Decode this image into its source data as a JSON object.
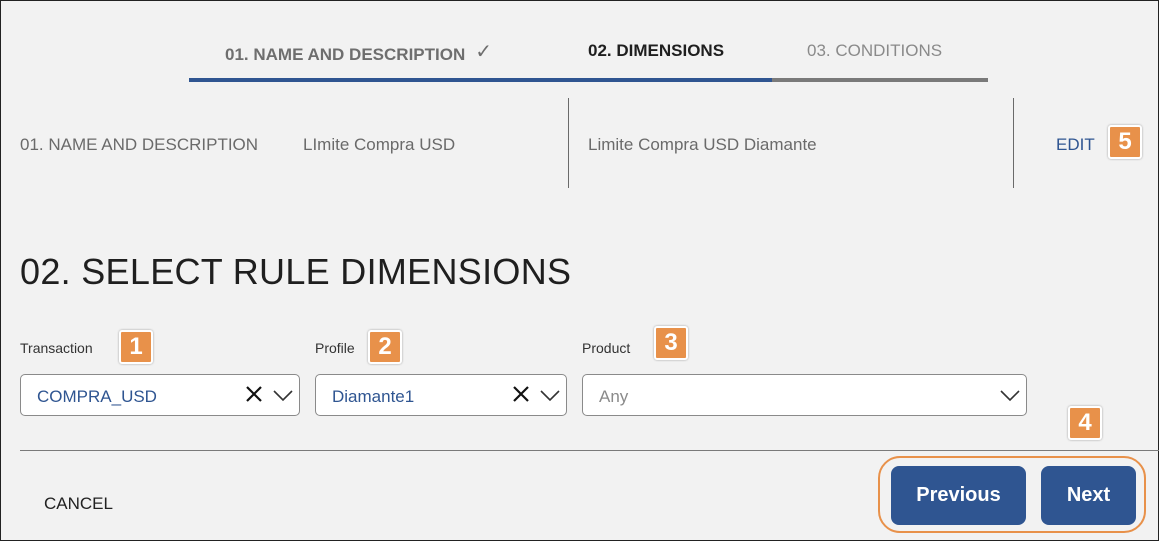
{
  "stepper": {
    "steps": [
      {
        "label": "01. NAME AND DESCRIPTION",
        "state": "completed",
        "icon": "check-icon"
      },
      {
        "label": "02. DIMENSIONS",
        "state": "active"
      },
      {
        "label": "03. CONDITIONS",
        "state": "upcoming"
      }
    ],
    "progress_fraction": 0.73,
    "colors": {
      "progress_fill": "#2f5591",
      "progress_track": "#7a7a7a"
    }
  },
  "summary": {
    "step_label": "01. NAME AND DESCRIPTION",
    "name": "LImite Compra USD",
    "description": "Limite Compra USD Diamante",
    "edit_label": "EDIT"
  },
  "section": {
    "title": "02. SELECT RULE DIMENSIONS"
  },
  "fields": [
    {
      "label": "Transaction",
      "value": "COMPRA_USD",
      "placeholder": "",
      "clearable": true
    },
    {
      "label": "Profile",
      "value": "Diamante1",
      "placeholder": "",
      "clearable": true
    },
    {
      "label": "Product",
      "value": "",
      "placeholder": "Any",
      "clearable": false
    }
  ],
  "callouts": [
    "1",
    "2",
    "3",
    "4",
    "5"
  ],
  "footer": {
    "cancel_label": "CANCEL",
    "previous_label": "Previous",
    "next_label": "Next"
  },
  "colors": {
    "accent": "#2f5591",
    "callout": "#e8914a",
    "background": "#f2f2f2"
  }
}
